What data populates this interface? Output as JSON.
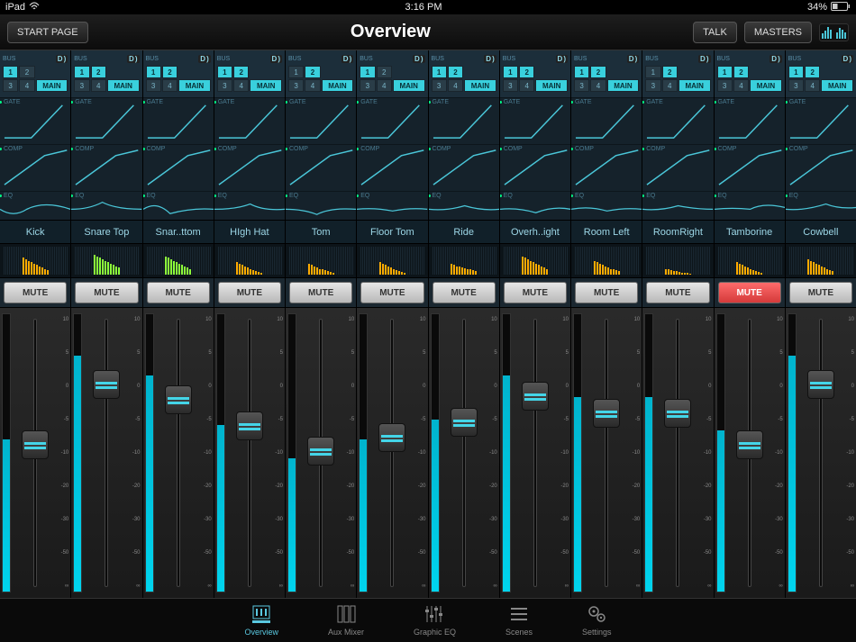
{
  "status": {
    "device": "iPad",
    "time": "3:16 PM",
    "battery": "34%"
  },
  "header": {
    "start_page": "START PAGE",
    "title": "Overview",
    "talk": "TALK",
    "masters": "MASTERS"
  },
  "labels": {
    "bus": "BUS",
    "d": "D",
    "main": "MAIN",
    "gate": "GATE",
    "comp": "COMP",
    "eq": "EQ",
    "mute": "MUTE"
  },
  "fader_scale": [
    "10",
    "5",
    "0",
    "-5",
    "-10",
    "-20",
    "-30",
    "-50",
    "∞"
  ],
  "channels": [
    {
      "name": "Kick",
      "bus_lit": [
        1
      ],
      "mute": false,
      "fader": 38,
      "meter": 55,
      "strip": [
        60,
        55,
        50,
        45,
        40,
        35,
        30,
        25,
        20,
        15
      ],
      "strip_color": "#ffaa00"
    },
    {
      "name": "Snare Top",
      "bus_lit": [
        1,
        2
      ],
      "mute": false,
      "fader": 70,
      "meter": 85,
      "strip": [
        70,
        65,
        60,
        55,
        50,
        45,
        40,
        35,
        30,
        25
      ],
      "strip_color": "#8cff3a"
    },
    {
      "name": "Snar..ttom",
      "bus_lit": [
        1,
        2
      ],
      "mute": false,
      "fader": 62,
      "meter": 78,
      "strip": [
        65,
        60,
        55,
        50,
        45,
        40,
        35,
        30,
        25,
        20
      ],
      "strip_color": "#8cff3a"
    },
    {
      "name": "HIgh Hat",
      "bus_lit": [
        1,
        2
      ],
      "mute": false,
      "fader": 48,
      "meter": 60,
      "strip": [
        45,
        40,
        35,
        30,
        25,
        20,
        15,
        12,
        10,
        8
      ],
      "strip_color": "#ffaa00"
    },
    {
      "name": "Tom",
      "bus_lit": [
        2
      ],
      "mute": false,
      "fader": 35,
      "meter": 48,
      "strip": [
        40,
        35,
        30,
        25,
        20,
        18,
        15,
        12,
        10,
        8
      ],
      "strip_color": "#ffaa00"
    },
    {
      "name": "Floor Tom",
      "bus_lit": [
        1
      ],
      "mute": false,
      "fader": 42,
      "meter": 55,
      "strip": [
        45,
        40,
        35,
        30,
        25,
        20,
        15,
        12,
        10,
        8
      ],
      "strip_color": "#ffaa00"
    },
    {
      "name": "Ride",
      "bus_lit": [
        1,
        2
      ],
      "mute": false,
      "fader": 50,
      "meter": 62,
      "strip": [
        40,
        35,
        30,
        28,
        25,
        22,
        20,
        18,
        15,
        12
      ],
      "strip_color": "#ffaa00"
    },
    {
      "name": "Overh..ight",
      "bus_lit": [
        1,
        2
      ],
      "mute": false,
      "fader": 64,
      "meter": 78,
      "strip": [
        65,
        60,
        55,
        50,
        45,
        40,
        35,
        30,
        25,
        20
      ],
      "strip_color": "#ffaa00"
    },
    {
      "name": "Room Left",
      "bus_lit": [
        1,
        2
      ],
      "mute": false,
      "fader": 55,
      "meter": 70,
      "strip": [
        50,
        45,
        40,
        35,
        30,
        25,
        20,
        18,
        15,
        12
      ],
      "strip_color": "#ffaa00"
    },
    {
      "name": "RoomRight",
      "bus_lit": [
        2
      ],
      "mute": false,
      "fader": 55,
      "meter": 70,
      "strip": [
        20,
        18,
        16,
        14,
        12,
        10,
        8,
        6,
        5,
        4
      ],
      "strip_color": "#ffaa00"
    },
    {
      "name": "Tamborine",
      "bus_lit": [
        1,
        2
      ],
      "mute": true,
      "fader": 38,
      "meter": 58,
      "strip": [
        45,
        40,
        35,
        30,
        25,
        20,
        15,
        12,
        10,
        8
      ],
      "strip_color": "#ffaa00"
    },
    {
      "name": "Cowbell",
      "bus_lit": [
        1,
        2
      ],
      "mute": false,
      "fader": 70,
      "meter": 85,
      "strip": [
        55,
        50,
        45,
        40,
        35,
        30,
        25,
        20,
        15,
        12
      ],
      "strip_color": "#ffaa00"
    }
  ],
  "nav": [
    {
      "label": "Overview",
      "active": true
    },
    {
      "label": "Aux Mixer",
      "active": false
    },
    {
      "label": "Graphic EQ",
      "active": false
    },
    {
      "label": "Scenes",
      "active": false
    },
    {
      "label": "Settings",
      "active": false
    }
  ]
}
